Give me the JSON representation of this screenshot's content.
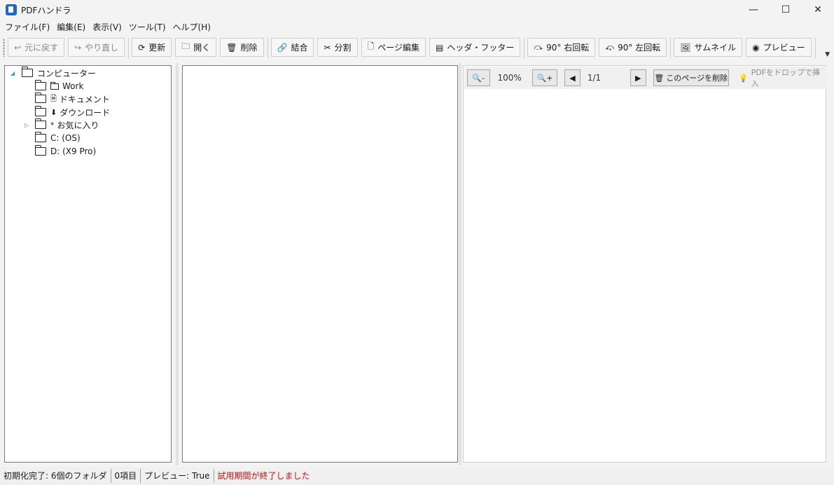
{
  "window": {
    "title": "PDFハンドラ",
    "controls": {
      "minimize": "—",
      "maximize": "☐",
      "close": "✕"
    }
  },
  "menu": [
    "ファイル(F)",
    "編集(E)",
    "表示(V)",
    "ツール(T)",
    "ヘルプ(H)"
  ],
  "toolbar": {
    "undo": "元に戻す",
    "redo": "やり直し",
    "refresh": "更新",
    "open": "開く",
    "delete": "削除",
    "merge": "結合",
    "split": "分割",
    "page_edit": "ページ編集",
    "header_footer": "ヘッダ・フッター",
    "rotate_right": "90° 右回転",
    "rotate_left": "90° 左回転",
    "thumbnail": "サムネイル",
    "preview": "プレビュー"
  },
  "tree": {
    "root": "コンピューター",
    "items": [
      {
        "label": "Work",
        "icon": "folder-icon"
      },
      {
        "label": "ドキュメント",
        "icon": "document-icon"
      },
      {
        "label": "ダウンロード",
        "icon": "download-icon"
      },
      {
        "label": "お気に入り",
        "icon": "star-icon"
      },
      {
        "label": "C: (OS)",
        "icon": "drive-icon"
      },
      {
        "label": "D: (X9 Pro)",
        "icon": "drive-icon"
      }
    ]
  },
  "preview": {
    "zoom_out": "-",
    "zoom_level": "100%",
    "zoom_in": "+",
    "page_indicator": "1/1",
    "delete_page": "このページを削除",
    "drop_hint": "PDFをドロップで挿入"
  },
  "status": {
    "init": "初期化完了: 6個のフォルダ",
    "items": "0項目",
    "preview": "プレビュー: True",
    "trial": "試用期間が終了しました",
    "trial_color": "#d01010"
  }
}
